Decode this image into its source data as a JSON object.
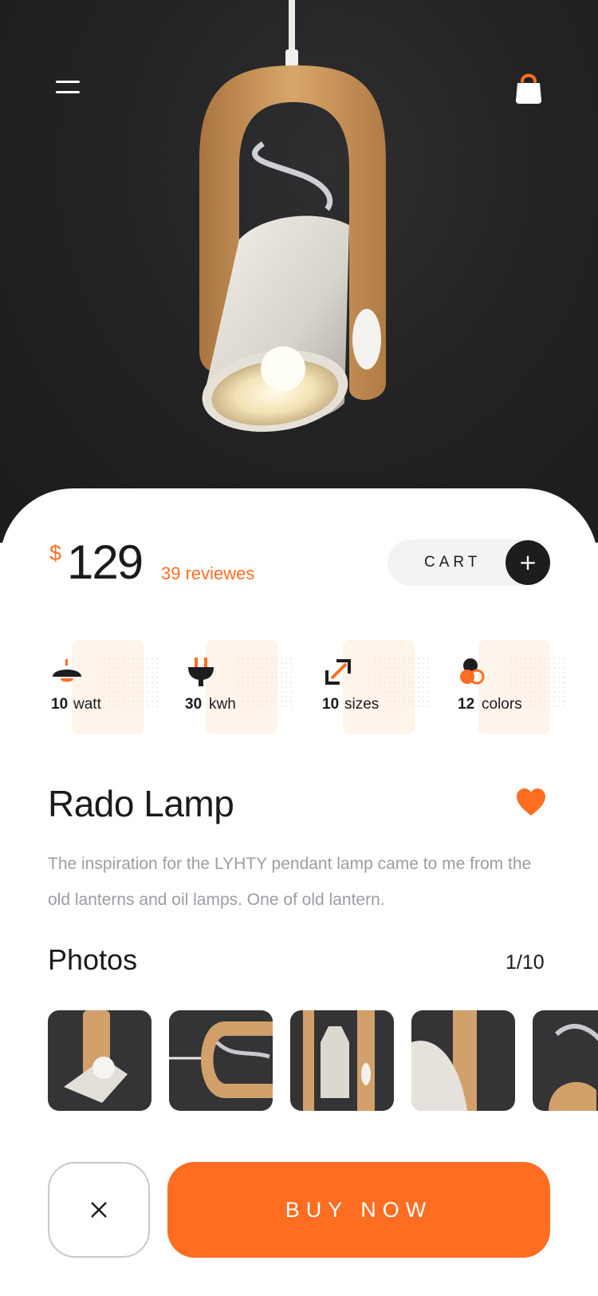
{
  "colors": {
    "accent": "#ff6d21",
    "dark": "#1d1d1f",
    "muted": "#9b9da3"
  },
  "header": {
    "menu_icon": "hamburger-icon",
    "cart_icon": "shopping-bag-icon"
  },
  "product": {
    "currency": "$",
    "price": "129",
    "reviews": "39 reviewes",
    "cart_label": "CART",
    "cart_add_symbol": "+",
    "name": "Rado Lamp",
    "favorite": true,
    "description": "The inspiration for the LYHTY pendant lamp came to me from the old lanterns and oil lamps. One of old lantern."
  },
  "specs": [
    {
      "value": "10",
      "unit": "watt",
      "icon": "lamp-icon"
    },
    {
      "value": "30",
      "unit": "kwh",
      "icon": "plug-icon"
    },
    {
      "value": "10",
      "unit": "sizes",
      "icon": "resize-arrow-icon"
    },
    {
      "value": "12",
      "unit": "colors",
      "icon": "color-palette-icon"
    }
  ],
  "photos": {
    "title": "Photos",
    "count": "1/10"
  },
  "actions": {
    "close_symbol": "×",
    "buy_label": "BUY NOW"
  }
}
